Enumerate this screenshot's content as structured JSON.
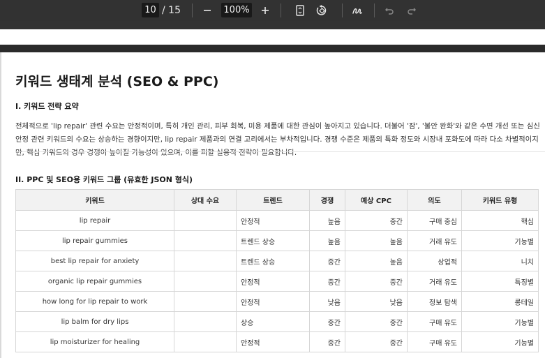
{
  "toolbar": {
    "page_current": "10",
    "page_total": "/ 15",
    "zoom": "100%",
    "icons": [
      "minus-icon",
      "plus-icon",
      "fit-page-icon",
      "rotate-icon",
      "draw-icon",
      "undo-icon",
      "redo-icon"
    ]
  },
  "document": {
    "title": "키워드 생태계 분석 (SEO & PPC)",
    "section1_heading": "I. 키워드 전략 요약",
    "section1_body": "전체적으로 'lip repair' 관련 수요는 안정적이며, 특히 개인 관리, 피부 회복, 미용 제품에 대한 관심이 높아지고 있습니다. 더불어 '잠', '불안 완화'와 같은 수면 개선 또는 심신 안정 관련 키워드의 수요는 상승하는 경향이지만, lip repair 제품과의 연결 고리에서는 부차적입니다. 경쟁 수준은 제품의 특화 정도와 시장내 포화도에 따라 다소 차별적이지만, 핵심 키워드의 경우 경쟁이 높아질 가능성이 있으며, 이를 피할 실용적 전략이 필요합니다.",
    "section2_heading": "II. PPC 및 SEO용 키워드 그룹 (유효한 JSON 형식)",
    "table": {
      "headers": [
        "키워드",
        "상대 수요",
        "트렌드",
        "경쟁",
        "예상 CPC",
        "의도",
        "키워드 유형"
      ],
      "rows": [
        [
          "lip repair",
          "",
          "안정적",
          "높음",
          "중간",
          "구매 중심",
          "핵심"
        ],
        [
          "lip repair gummies",
          "",
          "트렌드 상승",
          "높음",
          "높음",
          "거래 유도",
          "기능별"
        ],
        [
          "best lip repair for anxiety",
          "",
          "트렌드 상승",
          "중간",
          "높음",
          "상업적",
          "니치"
        ],
        [
          "organic lip repair gummies",
          "",
          "안정적",
          "중간",
          "중간",
          "거래 유도",
          "특징별"
        ],
        [
          "how long for lip repair to work",
          "",
          "안정적",
          "낮음",
          "낮음",
          "정보 탐색",
          "롱테일"
        ],
        [
          "lip balm for dry lips",
          "",
          "상승",
          "중간",
          "중간",
          "구매 유도",
          "기능별"
        ],
        [
          "lip moisturizer for healing",
          "",
          "안정적",
          "중간",
          "중간",
          "구매 유도",
          "기능별"
        ]
      ]
    }
  }
}
